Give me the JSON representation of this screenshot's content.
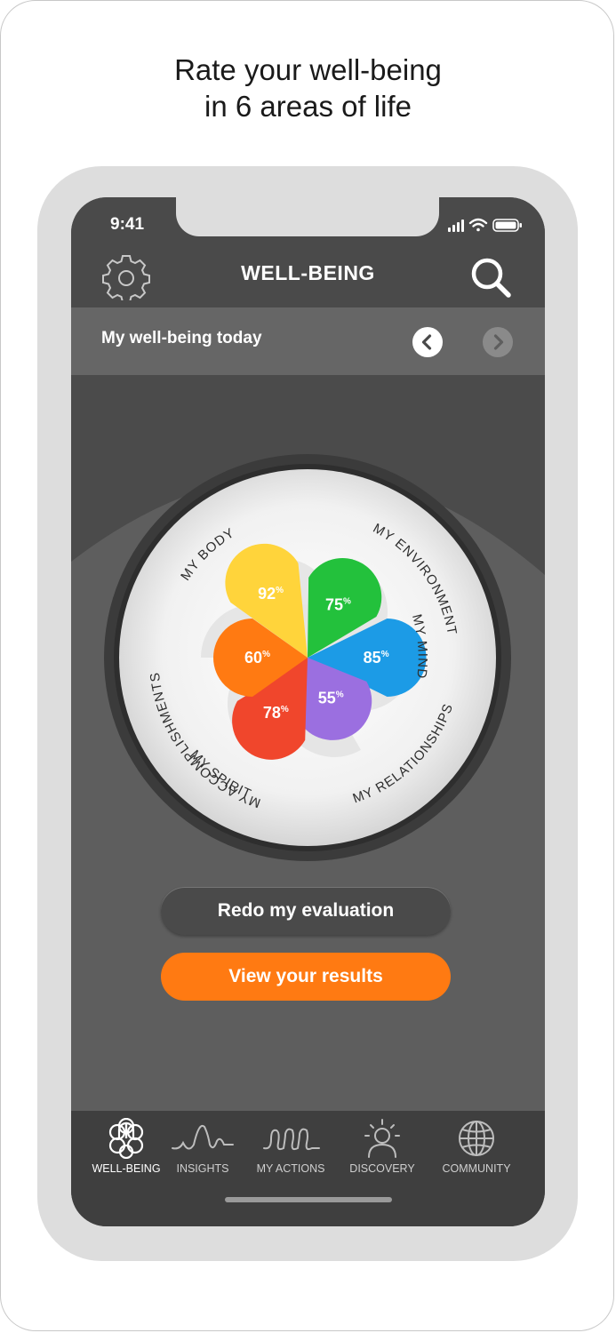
{
  "headline": {
    "line1": "Rate your well-being",
    "line2": "in 6 areas of life"
  },
  "status_bar": {
    "time": "9:41",
    "icons": [
      "signal-icon",
      "wifi-icon",
      "battery-icon"
    ]
  },
  "app_bar": {
    "title": "WELL-BEING",
    "left_icon": "gear-icon",
    "right_icon": "search-icon"
  },
  "date_bar": {
    "label": "My well-being today",
    "prev_icon": "chevron-left-icon",
    "next_icon": "chevron-right-icon"
  },
  "wheel": {
    "areas": [
      {
        "name": "MY BODY",
        "value": "92",
        "unit": "%",
        "color": "#ffd43b"
      },
      {
        "name": "MY ENVIRONMENT",
        "value": "75",
        "unit": "%",
        "color": "#23c13c"
      },
      {
        "name": "MY MIND",
        "value": "85",
        "unit": "%",
        "color": "#1c9be6"
      },
      {
        "name": "MY SPIRIT",
        "value": "55",
        "unit": "%",
        "color": "#9b6fe0"
      },
      {
        "name": "MY RELATIONSHIPS",
        "value": "78",
        "unit": "%",
        "color": "#f0462c"
      },
      {
        "name": "MY ACCOMPLISHMENTS",
        "value": "60",
        "unit": "%",
        "color": "#ff7a12"
      }
    ]
  },
  "buttons": {
    "redo": "Redo my evaluation",
    "view": "View your results"
  },
  "tabs": [
    {
      "label": "WELL-BEING",
      "icon": "flower-icon",
      "active": true
    },
    {
      "label": "INSIGHTS",
      "icon": "wave-icon",
      "active": false
    },
    {
      "label": "MY ACTIONS",
      "icon": "loops-icon",
      "active": false
    },
    {
      "label": "DISCOVERY",
      "icon": "person-idea-icon",
      "active": false
    },
    {
      "label": "COMMUNITY",
      "icon": "globe-icon",
      "active": false
    }
  ],
  "colors": {
    "accent": "#ff7a12",
    "screen_bg": "#5e5e5e",
    "bar_bg": "#4a4a4a"
  }
}
